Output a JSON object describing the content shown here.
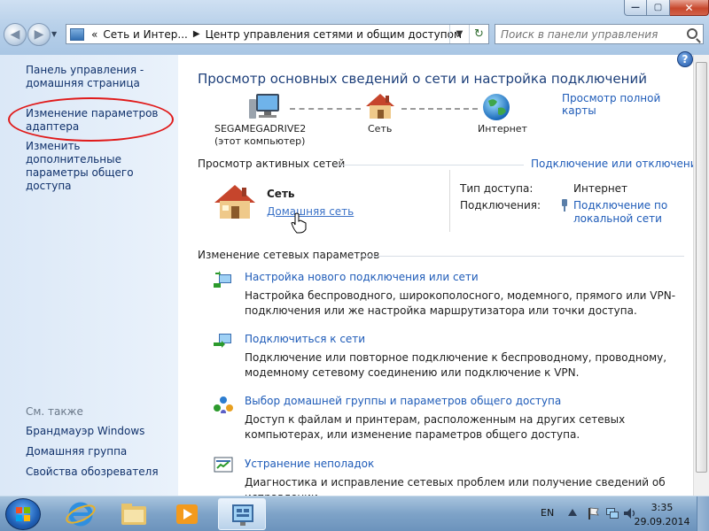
{
  "window": {
    "min_glyph": "—",
    "max_glyph": "▢",
    "close_glyph": "✕"
  },
  "nav": {
    "back_glyph": "◀",
    "forward_glyph": "▶",
    "dropdown_glyph": "▼"
  },
  "address": {
    "chevron": "«",
    "crumb1": "Сеть и Интер...",
    "crumb_sep": "▶",
    "crumb2": "Центр управления сетями и общим доступом",
    "dropdown_glyph": "▼",
    "refresh_glyph": "↻"
  },
  "search": {
    "placeholder": "Поиск в панели управления"
  },
  "sidebar": {
    "home_link": "Панель управления - домашняя страница",
    "adapter_link": "Изменение параметров адаптера",
    "sharing_link": "Изменить дополнительные параметры общего доступа",
    "see_also": "См. также",
    "firewall_link": "Брандмауэр Windows",
    "homegroup_link": "Домашняя группа",
    "browser_props_link": "Свойства обозревателя"
  },
  "main": {
    "help_glyph": "?",
    "title": "Просмотр основных сведений о сети и настройка подключений",
    "full_map_link": "Просмотр полной карты",
    "map": {
      "computer_name": "SEGAMEGADRIVE2",
      "computer_sub": "(этот компьютер)",
      "network_label": "Сеть",
      "internet_label": "Интернет"
    },
    "active": {
      "section_title": "Просмотр активных сетей",
      "connect_link": "Подключение или отключение",
      "network_name": "Сеть",
      "network_type": "Домашняя сеть",
      "access_type_key": "Тип доступа:",
      "access_type_val": "Интернет",
      "connections_key": "Подключения:",
      "connections_val": "Подключение по локальной сети"
    },
    "change": {
      "section_title": "Изменение сетевых параметров",
      "tasks": [
        {
          "title": "Настройка нового подключения или сети",
          "desc": "Настройка беспроводного, широкополосного, модемного, прямого или VPN-подключения или же настройка маршрутизатора или точки доступа."
        },
        {
          "title": "Подключиться к сети",
          "desc": "Подключение или повторное подключение к беспроводному, проводному, модемному сетевому соединению или подключение к VPN."
        },
        {
          "title": "Выбор домашней группы и параметров общего доступа",
          "desc": "Доступ к файлам и принтерам, расположенным на других сетевых компьютерах, или изменение параметров общего доступа."
        },
        {
          "title": "Устранение неполадок",
          "desc": "Диагностика и исправление сетевых проблем или получение сведений об исправлении."
        }
      ]
    }
  },
  "taskbar": {
    "lang": "EN",
    "time": "3:35",
    "date": "29.09.2014"
  },
  "colors": {
    "annotation_ellipse": "#e01a1a",
    "link": "#1e5bb8",
    "title": "#1d3f7a"
  }
}
